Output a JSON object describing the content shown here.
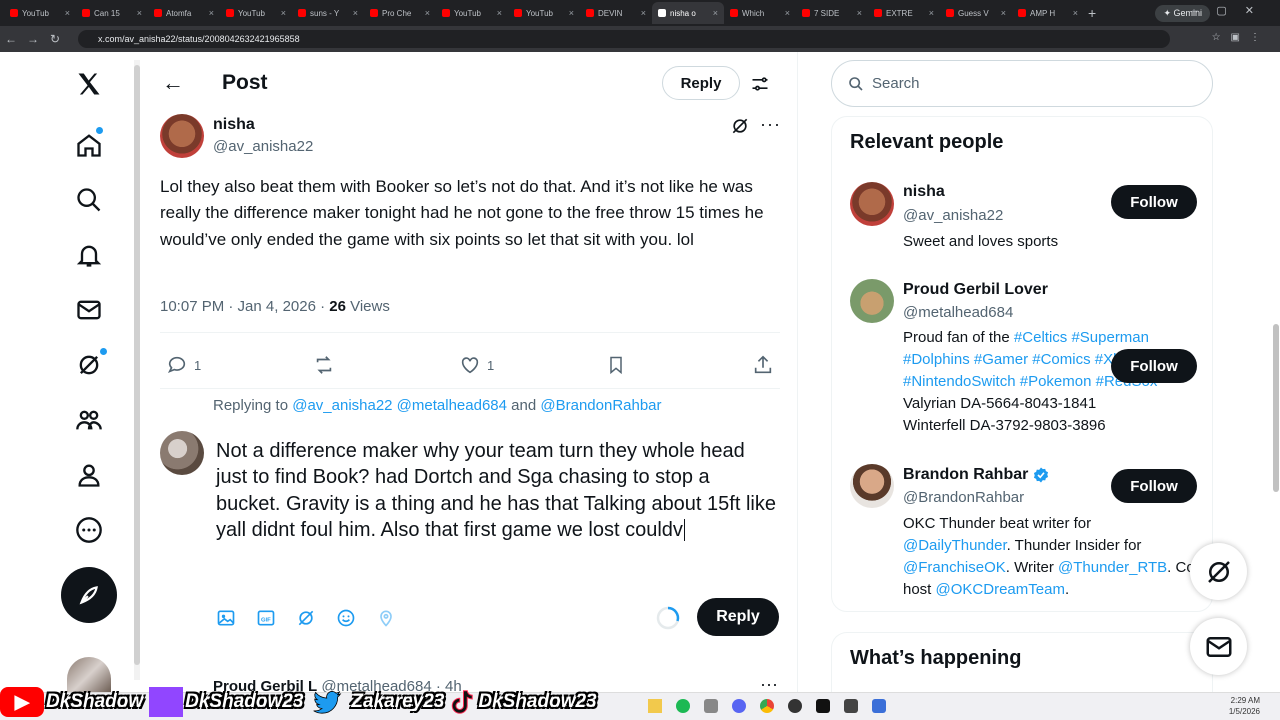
{
  "browser": {
    "tabs": [
      {
        "label": "YouTub",
        "icon": "youtube-icon"
      },
      {
        "label": "Can 15",
        "icon": "youtube-icon"
      },
      {
        "label": "Atomfa",
        "icon": "youtube-icon"
      },
      {
        "label": "YouTub",
        "icon": "youtube-icon"
      },
      {
        "label": "suns - Y",
        "icon": "youtube-icon"
      },
      {
        "label": "Pro Che",
        "icon": "youtube-icon"
      },
      {
        "label": "YouTub",
        "icon": "youtube-icon"
      },
      {
        "label": "YouTub",
        "icon": "youtube-icon"
      },
      {
        "label": "DEVIN",
        "icon": "youtube-icon"
      },
      {
        "label": "nisha o",
        "icon": "x-icon",
        "active": true
      },
      {
        "label": "Which",
        "icon": "youtube-icon"
      },
      {
        "label": "7 SIDE",
        "icon": "youtube-icon"
      },
      {
        "label": "EXTRE",
        "icon": "youtube-icon"
      },
      {
        "label": "Guess V",
        "icon": "youtube-icon"
      },
      {
        "label": "AMP H",
        "icon": "youtube-icon"
      }
    ],
    "gemini_label": "✦ Gemini",
    "url": "x.com/av_anisha22/status/2008042632421965858"
  },
  "header": {
    "title": "Post",
    "reply_label": "Reply"
  },
  "post": {
    "name": "nisha",
    "handle": "@av_anisha22",
    "text": "Lol they also beat them with Booker so let’s not do that. And it’s not like he was really the difference maker tonight had he not gone to the free throw 15 times he would’ve only ended the game with six points so let that sit with you. lol",
    "time": "10:07 PM · Jan 4, 2026 · ",
    "views_count": "26",
    "views_label": " Views",
    "replies": "1",
    "likes": "1"
  },
  "composer": {
    "replying_prefix": "Replying to ",
    "replying_to": "@av_anisha22 @metalhead684",
    "and": " and ",
    "replying_last": "@BrandonRahbar",
    "draft": "Not a difference maker why your team turn they whole head just to find Book? had Dortch and Sga chasing to stop a bucket. Gravity is a thing and he has that Talking about 15ft like yall didnt foul him. Also that first game we lost couldv",
    "reply_label": "Reply"
  },
  "next_reply": {
    "name": "Proud Gerbil L",
    "handle": "@metalhead684",
    "age": "· 4h"
  },
  "search": {
    "placeholder": "Search"
  },
  "relevant": {
    "title": "Relevant people",
    "follow_label": "Follow",
    "people": [
      {
        "name": "nisha",
        "handle": "@av_anisha22",
        "bio": "Sweet and loves sports"
      },
      {
        "name": "Proud Gerbil Lover",
        "handle": "@metalhead684",
        "bio_prefix": "Proud fan of the ",
        "tags": "#Celtics #Superman #Dolphins #Gamer #Comics #Xbox #NintendoSwitch #Pokemon #RedSox",
        "line2": "Valyrian DA-5664-8043-1841",
        "line3": "Winterfell DA-3792-9803-3896"
      },
      {
        "name": "Brandon Rahbar",
        "handle": "@BrandonRahbar",
        "verified": true,
        "bio_a": "OKC Thunder beat writer for ",
        "link_a": "@DailyThunder",
        "bio_b": ". Thunder Insider for ",
        "link_b": "@FranchiseOK",
        "bio_c": ". Writer ",
        "link_c": "@Thunder_RTB",
        "bio_d": ". Co-host ",
        "link_d": "@OKCDreamTeam",
        "bio_e": "."
      }
    ]
  },
  "whats_happening": {
    "title": "What’s happening"
  },
  "overlay": {
    "names": [
      "DkShadow",
      "DkShadow23",
      "Zakarey23",
      "DkShadow23"
    ]
  },
  "taskbar": {
    "time": "2:29 AM",
    "date": "1/5/2026"
  },
  "colors": {
    "accent": "#1d9bf0",
    "text": "#0f1419",
    "muted": "#536471"
  }
}
